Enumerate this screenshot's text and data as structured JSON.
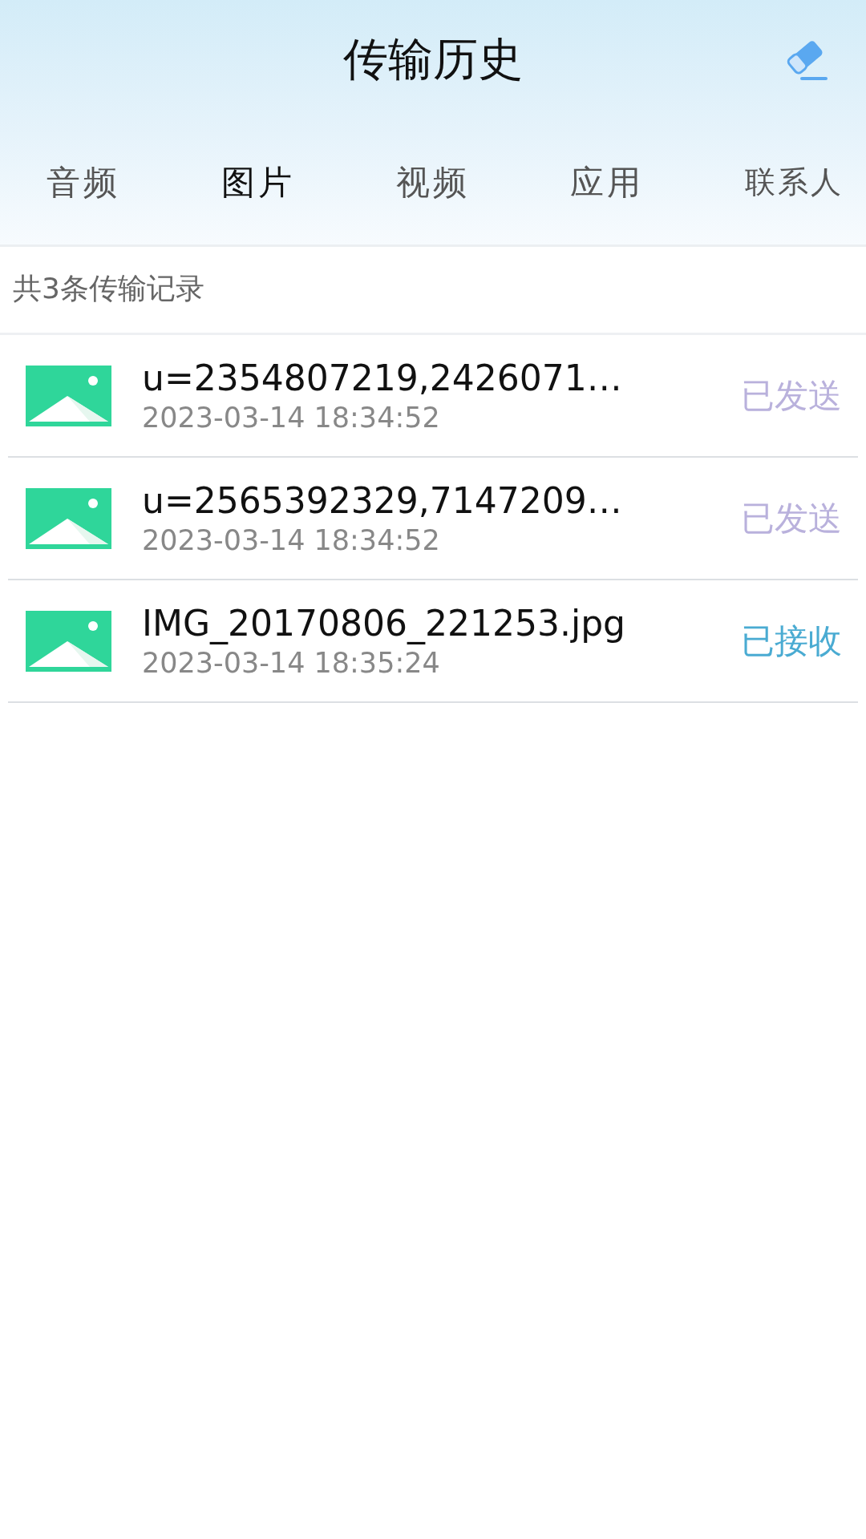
{
  "header": {
    "title": "传输历史"
  },
  "tabs": [
    {
      "label": "音频",
      "selected": false
    },
    {
      "label": "图片",
      "selected": true
    },
    {
      "label": "视频",
      "selected": false
    },
    {
      "label": "应用",
      "selected": false
    },
    {
      "label": "联系人",
      "selected": false
    }
  ],
  "summary": "共3条传输记录",
  "records": [
    {
      "name": "u=2354807219,2426071…",
      "time": "2023-03-14 18:34:52",
      "status": "已发送",
      "color": "#b9b1dc"
    },
    {
      "name": "u=2565392329,7147209…",
      "time": "2023-03-14 18:34:52",
      "status": "已发送",
      "color": "#b9b1dc"
    },
    {
      "name": "IMG_20170806_221253.jpg",
      "time": "2023-03-14 18:35:24",
      "status": "已接收",
      "color": "#4aabd2"
    }
  ]
}
